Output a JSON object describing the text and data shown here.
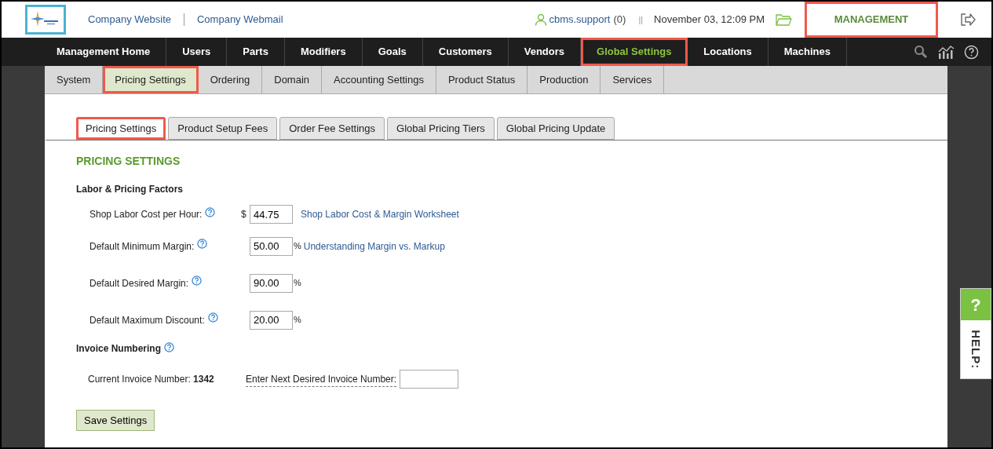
{
  "header": {
    "links": [
      "Company Website",
      "Company Webmail"
    ],
    "user": "cbms.support",
    "user_count": "(0)",
    "separator": "||",
    "datetime": "November 03, 12:09 PM",
    "area": {
      "label": "MANAGEMENT",
      "highlighted": true
    }
  },
  "main_nav": [
    {
      "label": "Management Home",
      "selected": false,
      "highlighted": false
    },
    {
      "label": "Users",
      "selected": false,
      "highlighted": false
    },
    {
      "label": "Parts",
      "selected": false,
      "highlighted": false
    },
    {
      "label": "Modifiers",
      "selected": false,
      "highlighted": false
    },
    {
      "label": "Goals",
      "selected": false,
      "highlighted": false
    },
    {
      "label": "Customers",
      "selected": false,
      "highlighted": false
    },
    {
      "label": "Vendors",
      "selected": false,
      "highlighted": false
    },
    {
      "label": "Global Settings",
      "selected": true,
      "highlighted": true
    },
    {
      "label": "Locations",
      "selected": false,
      "highlighted": false
    },
    {
      "label": "Machines",
      "selected": false,
      "highlighted": false
    }
  ],
  "sub_nav": [
    {
      "label": "System",
      "selected": false,
      "highlighted": false
    },
    {
      "label": "Pricing Settings",
      "selected": true,
      "highlighted": true
    },
    {
      "label": "Ordering",
      "selected": false,
      "highlighted": false
    },
    {
      "label": "Domain",
      "selected": false,
      "highlighted": false
    },
    {
      "label": "Accounting Settings",
      "selected": false,
      "highlighted": false
    },
    {
      "label": "Product Status",
      "selected": false,
      "highlighted": false
    },
    {
      "label": "Production",
      "selected": false,
      "highlighted": false
    },
    {
      "label": "Services",
      "selected": false,
      "highlighted": false
    }
  ],
  "tabs": [
    {
      "label": "Pricing Settings",
      "selected": true,
      "highlighted": true
    },
    {
      "label": "Product Setup Fees",
      "selected": false,
      "highlighted": false
    },
    {
      "label": "Order Fee Settings",
      "selected": false,
      "highlighted": false
    },
    {
      "label": "Global Pricing Tiers",
      "selected": false,
      "highlighted": false
    },
    {
      "label": "Global Pricing Update",
      "selected": false,
      "highlighted": false
    }
  ],
  "title": "PRICING SETTINGS",
  "labor_section": {
    "heading": "Labor & Pricing Factors",
    "fields": [
      {
        "label": "Shop Labor Cost per Hour:",
        "prefix": "$",
        "value": "44.75",
        "link": "Shop Labor Cost & Margin Worksheet"
      },
      {
        "label": "Default Minimum Margin:",
        "suffix": "%",
        "value": "50.00",
        "link": "Understanding Margin vs. Markup"
      },
      {
        "label": "Default Desired Margin:",
        "suffix": "%",
        "value": "90.00"
      },
      {
        "label": "Default Maximum Discount:",
        "suffix": "%",
        "value": "20.00"
      }
    ]
  },
  "invoice_section": {
    "heading": "Invoice Numbering",
    "current_label": "Current Invoice Number:",
    "current_value": "1342",
    "next_label": "Enter Next Desired Invoice Number:"
  },
  "save_button": "Save Settings",
  "help_tab": {
    "icon": "?",
    "label": "HELP:"
  }
}
